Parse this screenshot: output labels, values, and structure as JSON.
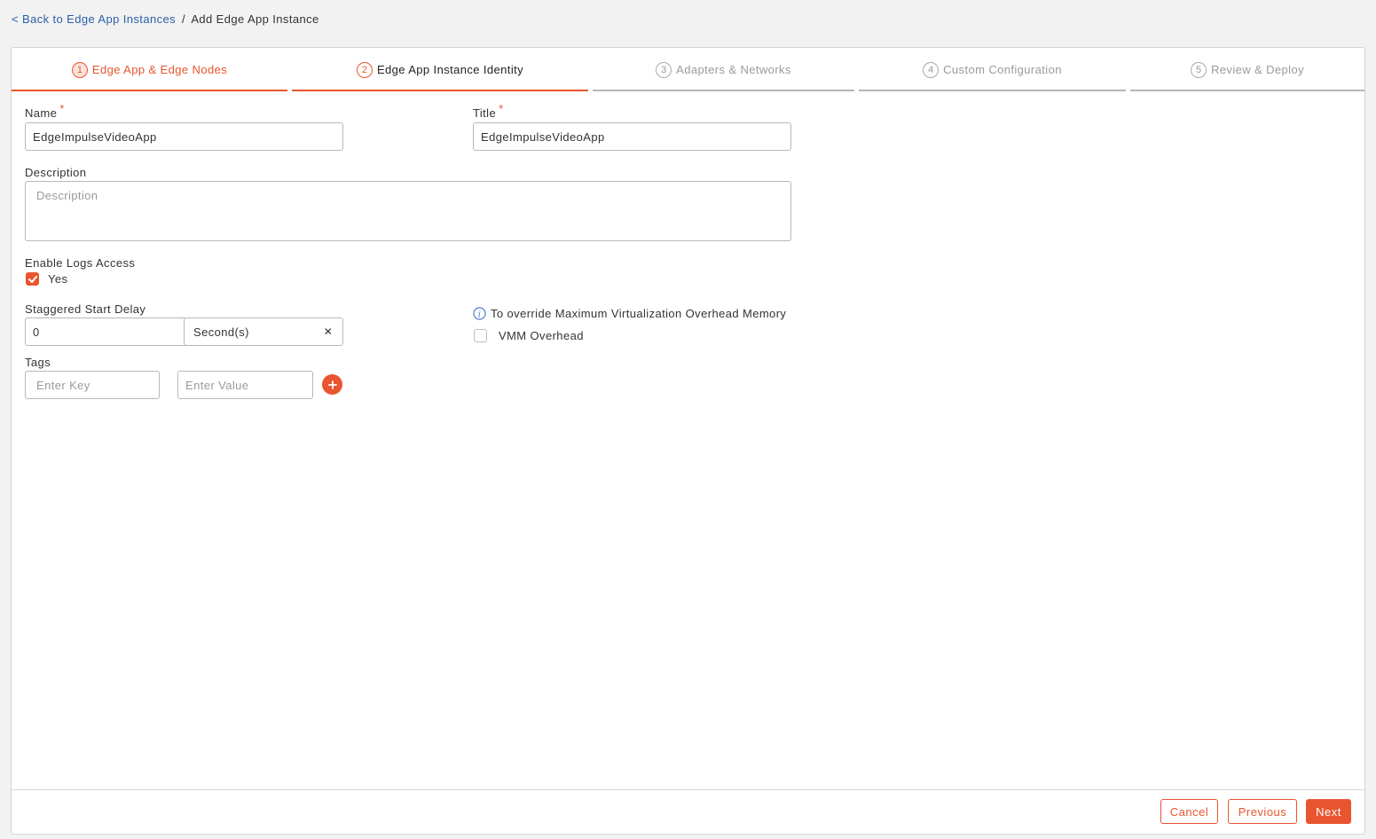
{
  "breadcrumb": {
    "back_link": "< Back to Edge App Instances",
    "separator": "/",
    "current": "Add Edge App Instance"
  },
  "steps": [
    {
      "number": "1",
      "label": "Edge App & Edge Nodes",
      "state": "done"
    },
    {
      "number": "2",
      "label": "Edge App Instance Identity",
      "state": "active"
    },
    {
      "number": "3",
      "label": "Adapters & Networks",
      "state": "pending"
    },
    {
      "number": "4",
      "label": "Custom Configuration",
      "state": "pending"
    },
    {
      "number": "5",
      "label": "Review & Deploy",
      "state": "pending"
    }
  ],
  "form": {
    "name": {
      "label": "Name",
      "required_mark": "*",
      "value": "EdgeImpulseVideoApp"
    },
    "title": {
      "label": "Title",
      "required_mark": "*",
      "value": "EdgeImpulseVideoApp"
    },
    "description": {
      "label": "Description",
      "value": "",
      "placeholder": "Description"
    },
    "logs_access": {
      "label": "Enable Logs Access",
      "option_label": "Yes",
      "checked": true
    },
    "staggered_start": {
      "label": "Staggered Start Delay",
      "value": "0",
      "unit": "Second(s)"
    },
    "vmm": {
      "info_text": "To override Maximum Virtualization Overhead Memory",
      "option_label": "VMM Overhead",
      "checked": false
    },
    "tags": {
      "label": "Tags",
      "key_placeholder": "Enter Key",
      "value_placeholder": "Enter Value"
    }
  },
  "footer": {
    "cancel_label": "Cancel",
    "previous_label": "Previous",
    "next_label": "Next"
  },
  "colors": {
    "accent": "#e8552f",
    "link": "#2b5fa8",
    "info": "#3b73c9"
  }
}
